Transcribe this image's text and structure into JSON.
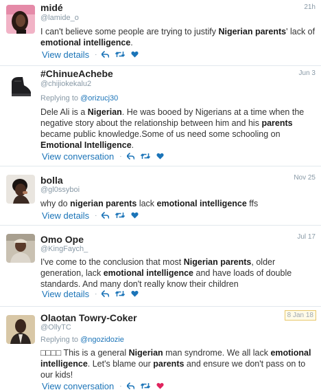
{
  "colors": {
    "link": "#1b74b8",
    "muted": "#8899a6",
    "divider": "#e1e8ed",
    "heart_liked": "#e0245e",
    "date_highlight": "#e8c66a"
  },
  "icons": [
    "reply-icon",
    "retweet-icon",
    "heart-icon"
  ],
  "tweets": [
    {
      "name": "midé",
      "handle": "@lamide_o",
      "time": "21h",
      "text": [
        {
          "t": "I can't believe some people are trying to justify "
        },
        {
          "t": "Nigerian parents",
          "b": true
        },
        {
          "t": "' lack of "
        },
        {
          "t": "emotional intelligence",
          "b": true
        },
        {
          "t": "."
        }
      ],
      "action": "View details"
    },
    {
      "name": "#ChinueAchebe",
      "handle": "@chijiokekalu2",
      "time": "Jun 3",
      "replying_label": "Replying to",
      "replying_to": "@orizucj30",
      "text": [
        {
          "t": "Dele Ali is a "
        },
        {
          "t": "Nigerian",
          "b": true
        },
        {
          "t": ". He was booed by Nigerians at a time when the negative story about the relationship between him and his "
        },
        {
          "t": "parents",
          "b": true
        },
        {
          "t": " became public knowledge.Some of us need some schooling on "
        },
        {
          "t": "Emotional Intelligence",
          "b": true
        },
        {
          "t": "."
        }
      ],
      "action": "View conversation"
    },
    {
      "name": "bolla",
      "handle": "@gl0ssyboi",
      "time": "Nov 25",
      "text": [
        {
          "t": "why do "
        },
        {
          "t": "nigerian parents",
          "b": true
        },
        {
          "t": " lack "
        },
        {
          "t": "emotional intelligence",
          "b": true
        },
        {
          "t": " ffs"
        }
      ],
      "action": "View details"
    },
    {
      "name": "Omo Ope",
      "handle": "@KingFaych_",
      "time": "Jul 17",
      "text": [
        {
          "t": "I've come to the conclusion that most "
        },
        {
          "t": "Nigerian parents",
          "b": true
        },
        {
          "t": ", older generation, lack "
        },
        {
          "t": "emotional intelligence",
          "b": true
        },
        {
          "t": " and have loads of double standards. And many don't really know their children"
        }
      ],
      "action": "View details"
    },
    {
      "name": "Olaotan Towry-Coker",
      "handle": "@OllyTC",
      "time": "8 Jan 18",
      "replying_label": "Replying to",
      "replying_to": "@ngozidozie",
      "text": [
        {
          "t": "□□□□ This is a general "
        },
        {
          "t": "Nigerian",
          "b": true
        },
        {
          "t": " man syndrome. We all lack "
        },
        {
          "t": "emotional intelligence",
          "b": true
        },
        {
          "t": ". Let's blame our "
        },
        {
          "t": "parents",
          "b": true
        },
        {
          "t": " and ensure we don't pass on to our kids!"
        }
      ],
      "action": "View conversation",
      "liked": true
    }
  ]
}
